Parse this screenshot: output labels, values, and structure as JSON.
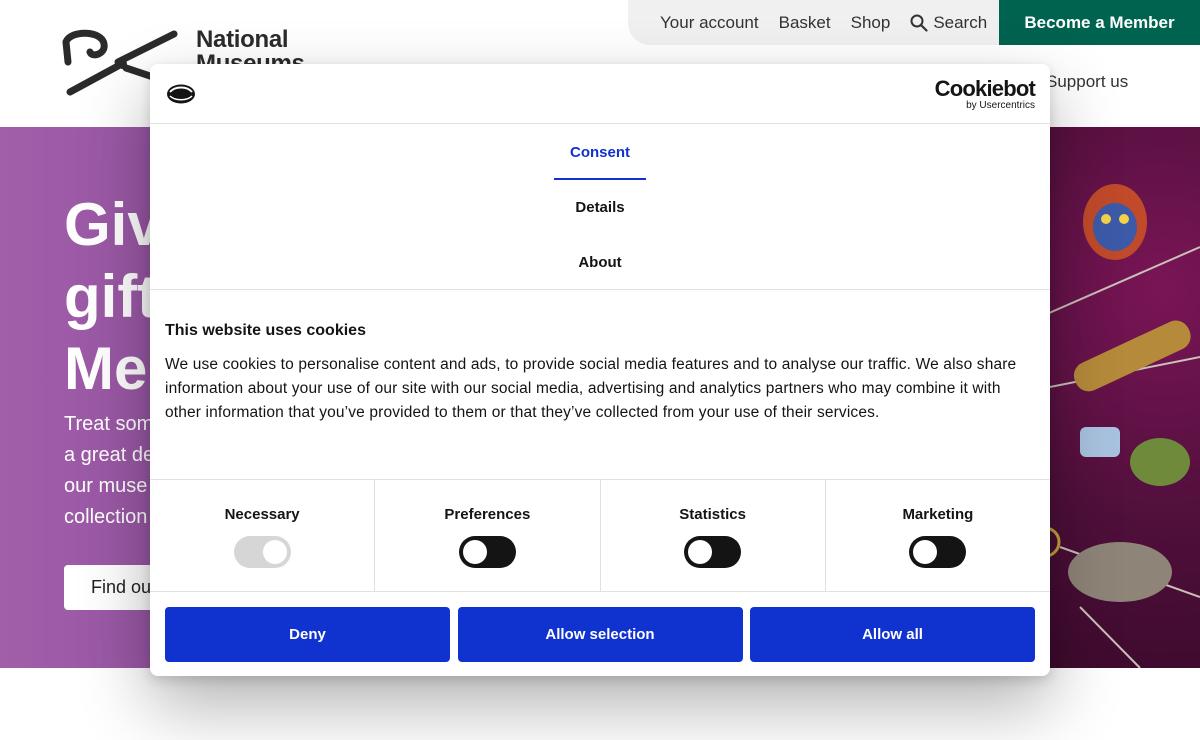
{
  "site": {
    "logo": {
      "line1": "National",
      "line2": "Museums"
    },
    "utility_nav": [
      "Your account",
      "Basket",
      "Shop",
      "Search"
    ],
    "member_button": "Become a Member",
    "support_link": "Support us",
    "hero": {
      "title_lines": [
        "Giv",
        "gift",
        "Me"
      ],
      "subtitle_lines": [
        "Treat som",
        "a great de",
        "our muse",
        "collection"
      ],
      "button": "Find ou"
    },
    "colors": {
      "member_green": "#00634f",
      "hero_purple": "#8a4a9c"
    }
  },
  "dialog": {
    "brand_name": "Cookiebot",
    "brand_sub": "by Usercentrics",
    "tabs": [
      "Consent",
      "Details",
      "About"
    ],
    "active_tab": "Consent",
    "heading": "This website uses cookies",
    "description": "We use cookies to personalise content and ads, to provide social media features and to analyse our traffic. We also share information about your use of our site with our social media, advertising and analytics partners who may combine it with other information that you’ve provided to them or that they’ve collected from your use of their services.",
    "toggles": [
      {
        "label": "Necessary",
        "state": "on-disabled"
      },
      {
        "label": "Preferences",
        "state": "off"
      },
      {
        "label": "Statistics",
        "state": "off"
      },
      {
        "label": "Marketing",
        "state": "off"
      }
    ],
    "buttons": [
      "Deny",
      "Allow selection",
      "Allow all"
    ],
    "colors": {
      "accent_blue": "#1032cf"
    }
  }
}
